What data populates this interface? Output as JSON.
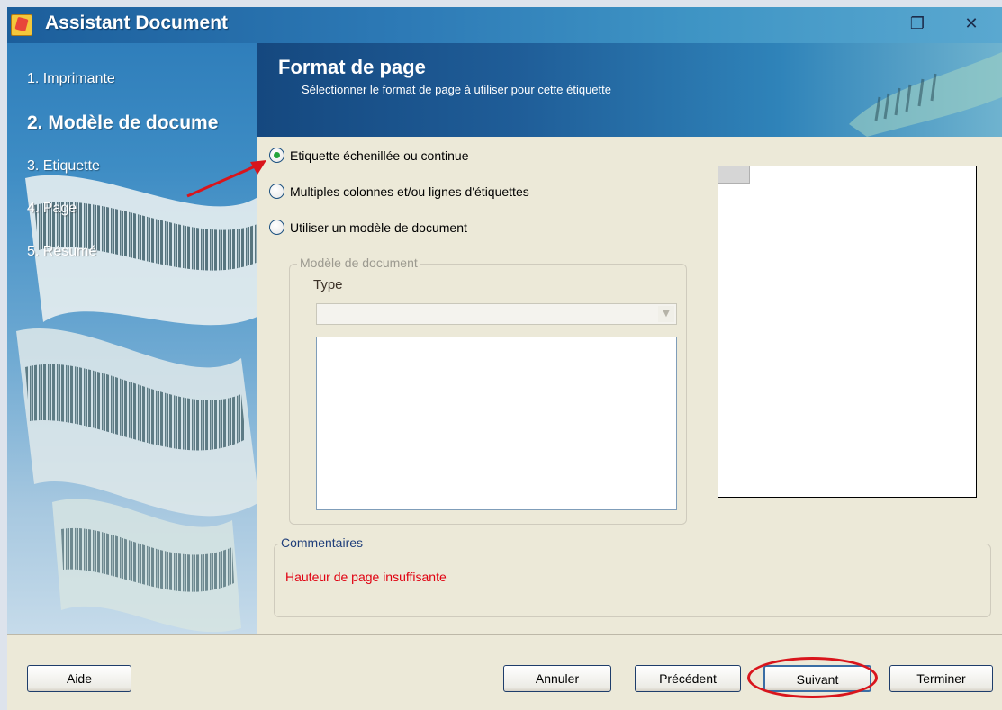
{
  "window": {
    "title": "Assistant Document",
    "restore_glyph": "❐",
    "close_glyph": "✕"
  },
  "steps": [
    {
      "label": "1. Imprimante",
      "active": false
    },
    {
      "label": "2. Modèle de docume",
      "active": true
    },
    {
      "label": "3. Etiquette",
      "active": false
    },
    {
      "label": "4. Page",
      "active": false
    },
    {
      "label": "5. Résumé",
      "active": false
    }
  ],
  "header": {
    "title": "Format de page",
    "subtitle": "Sélectionner le format de page à utiliser pour cette étiquette"
  },
  "options": [
    {
      "label": "Etiquette échenillée ou continue",
      "checked": true
    },
    {
      "label": "Multiples colonnes et/ou lignes d'étiquettes",
      "checked": false
    },
    {
      "label": "Utiliser un modèle de document",
      "checked": false
    }
  ],
  "template_group": {
    "legend": "Modèle de document",
    "type_label": "Type",
    "type_value": ""
  },
  "comments": {
    "legend": "Commentaires",
    "message": "Hauteur de page insuffisante"
  },
  "buttons": {
    "help": "Aide",
    "cancel": "Annuler",
    "previous": "Précédent",
    "next": "Suivant",
    "finish": "Terminer"
  },
  "colors": {
    "accent_blue": "#1f5d98",
    "annotation_red": "#d9151c",
    "comment_red": "#e00010"
  }
}
